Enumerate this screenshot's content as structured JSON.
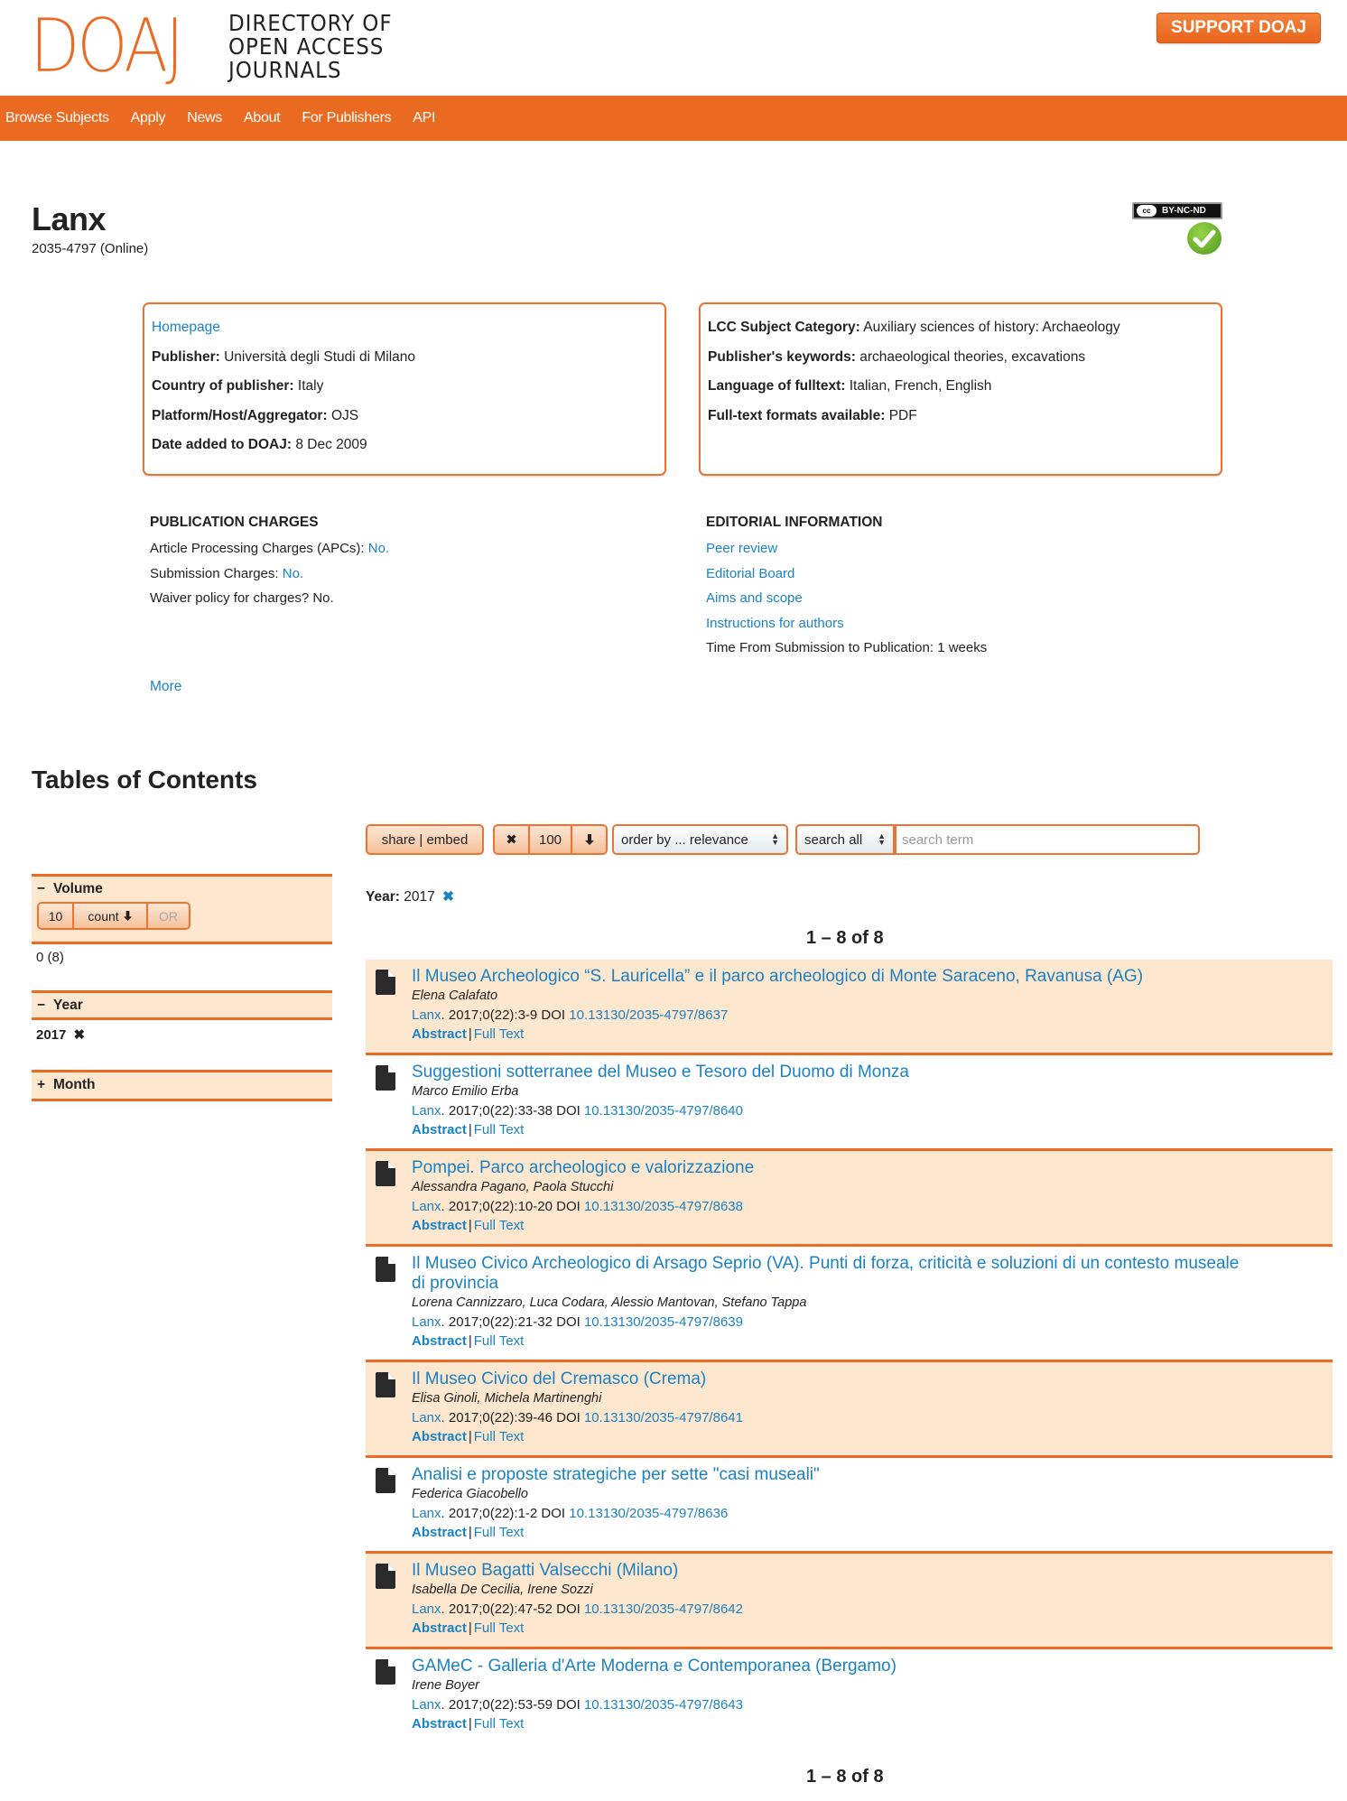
{
  "header": {
    "logo_mark": "DOAJ",
    "logo_text": [
      "DIRECTORY OF",
      "OPEN ACCESS",
      "JOURNALS"
    ],
    "support_button": "SUPPORT DOAJ",
    "nav": [
      "Browse Subjects",
      "Apply",
      "News",
      "About",
      "For Publishers",
      "API"
    ]
  },
  "journal": {
    "title": "Lanx",
    "issn": "2035-4797 (Online)",
    "license_badge": "BY-NC-ND",
    "license_cc": "cc",
    "seal_icon": "green-checkmark-icon"
  },
  "info_left": {
    "homepage_link": "Homepage",
    "rows": [
      {
        "label": "Publisher:",
        "value": "Università degli Studi di Milano"
      },
      {
        "label": "Country of publisher:",
        "value": "Italy"
      },
      {
        "label": "Platform/Host/Aggregator:",
        "value": "OJS"
      },
      {
        "label": "Date added to DOAJ:",
        "value": " 8 Dec 2009"
      }
    ]
  },
  "info_right": {
    "rows": [
      {
        "label": "LCC Subject Category:",
        "value": "Auxiliary sciences of history: Archaeology"
      },
      {
        "label": "Publisher's keywords:",
        "value": "archaeological theories, excavations"
      },
      {
        "label": "Language of fulltext:",
        "value": "Italian, French, English"
      },
      {
        "label": "Full-text formats available:",
        "value": "PDF"
      }
    ]
  },
  "publication_charges": {
    "heading": "PUBLICATION CHARGES",
    "apc_label": "Article Processing Charges (APCs):",
    "apc_value": "No.",
    "submission_label": "Submission Charges:",
    "submission_value": "No.",
    "waiver": "Waiver policy for charges? No."
  },
  "editorial": {
    "heading": "EDITORIAL INFORMATION",
    "links": [
      "Peer review",
      "Editorial Board",
      "Aims and scope",
      "Instructions for authors"
    ],
    "time_to_publication": "Time From Submission to Publication: 1 weeks"
  },
  "more_link": "More",
  "toc": {
    "title": "Tables of Contents",
    "toolbar": {
      "share_embed": "share | embed",
      "clear_icon": "✖",
      "page_size": "100",
      "sort_dir_icon": "🠗",
      "order_by": "order by ... relevance",
      "search_field": "search all",
      "search_placeholder": "search term",
      "search_value": ""
    },
    "active_filter": {
      "label": "Year:",
      "value": "2017",
      "remove": "✖"
    },
    "count_label": "1 – 8 of 8",
    "facets": {
      "volume": {
        "sign": "−",
        "label": "Volume",
        "size": "10",
        "sort": "count",
        "sort_icon": "🠗",
        "or": "OR",
        "value": "0 (8)"
      },
      "year": {
        "sign": "−",
        "label": "Year",
        "value": "2017",
        "remove": "✖"
      },
      "month": {
        "sign": "+",
        "label": "Month"
      }
    },
    "results": [
      {
        "title": "Il Museo Archeologico “S. Lauricella” e il parco archeologico di Monte Saraceno, Ravanusa (AG)",
        "authors": "Elena Calafato",
        "journal": "Lanx",
        "cite": ". 2017;0(22):3-9 DOI ",
        "doi": "10.13130/2035-4797/8637",
        "abstract": "Abstract",
        "fulltext": "Full Text"
      },
      {
        "title": "Suggestioni sotterranee del Museo e Tesoro del Duomo di Monza",
        "authors": "Marco Emilio Erba",
        "journal": "Lanx",
        "cite": ". 2017;0(22):33-38 DOI ",
        "doi": "10.13130/2035-4797/8640",
        "abstract": "Abstract",
        "fulltext": "Full Text"
      },
      {
        "title": "Pompei. Parco archeologico e valorizzazione",
        "authors": "Alessandra Pagano, Paola Stucchi",
        "journal": "Lanx",
        "cite": ". 2017;0(22):10-20 DOI ",
        "doi": "10.13130/2035-4797/8638",
        "abstract": "Abstract",
        "fulltext": "Full Text"
      },
      {
        "title": "Il Museo Civico Archeologico di Arsago Seprio (VA). Punti di forza, criticità e soluzioni di un contesto museale di provincia",
        "authors": "Lorena Cannizzaro, Luca Codara, Alessio Mantovan, Stefano Tappa",
        "journal": "Lanx",
        "cite": ". 2017;0(22):21-32 DOI ",
        "doi": "10.13130/2035-4797/8639",
        "abstract": "Abstract",
        "fulltext": "Full Text"
      },
      {
        "title": "Il Museo Civico del Cremasco (Crema)",
        "authors": "Elisa Ginoli, Michela Martinenghi",
        "journal": "Lanx",
        "cite": ". 2017;0(22):39-46 DOI ",
        "doi": "10.13130/2035-4797/8641",
        "abstract": "Abstract",
        "fulltext": "Full Text"
      },
      {
        "title": "Analisi e proposte strategiche per sette \"casi museali\"",
        "authors": "Federica Giacobello",
        "journal": "Lanx",
        "cite": ". 2017;0(22):1-2 DOI ",
        "doi": "10.13130/2035-4797/8636",
        "abstract": "Abstract",
        "fulltext": "Full Text"
      },
      {
        "title": "Il Museo Bagatti Valsecchi (Milano)",
        "authors": "Isabella De Cecilia, Irene Sozzi",
        "journal": "Lanx",
        "cite": ". 2017;0(22):47-52 DOI ",
        "doi": "10.13130/2035-4797/8642",
        "abstract": "Abstract",
        "fulltext": "Full Text"
      },
      {
        "title": "GAMeC - Galleria d'Arte Moderna e Contemporanea (Bergamo)",
        "authors": "Irene Boyer",
        "journal": "Lanx",
        "cite": ". 2017;0(22):53-59 DOI ",
        "doi": "10.13130/2035-4797/8643",
        "abstract": "Abstract",
        "fulltext": "Full Text"
      }
    ]
  },
  "colors": {
    "brand_orange": "#ea6a22",
    "link_blue": "#1a82c4",
    "facet_bg": "#fde8cf",
    "seal_green": "#4a9a1c"
  }
}
